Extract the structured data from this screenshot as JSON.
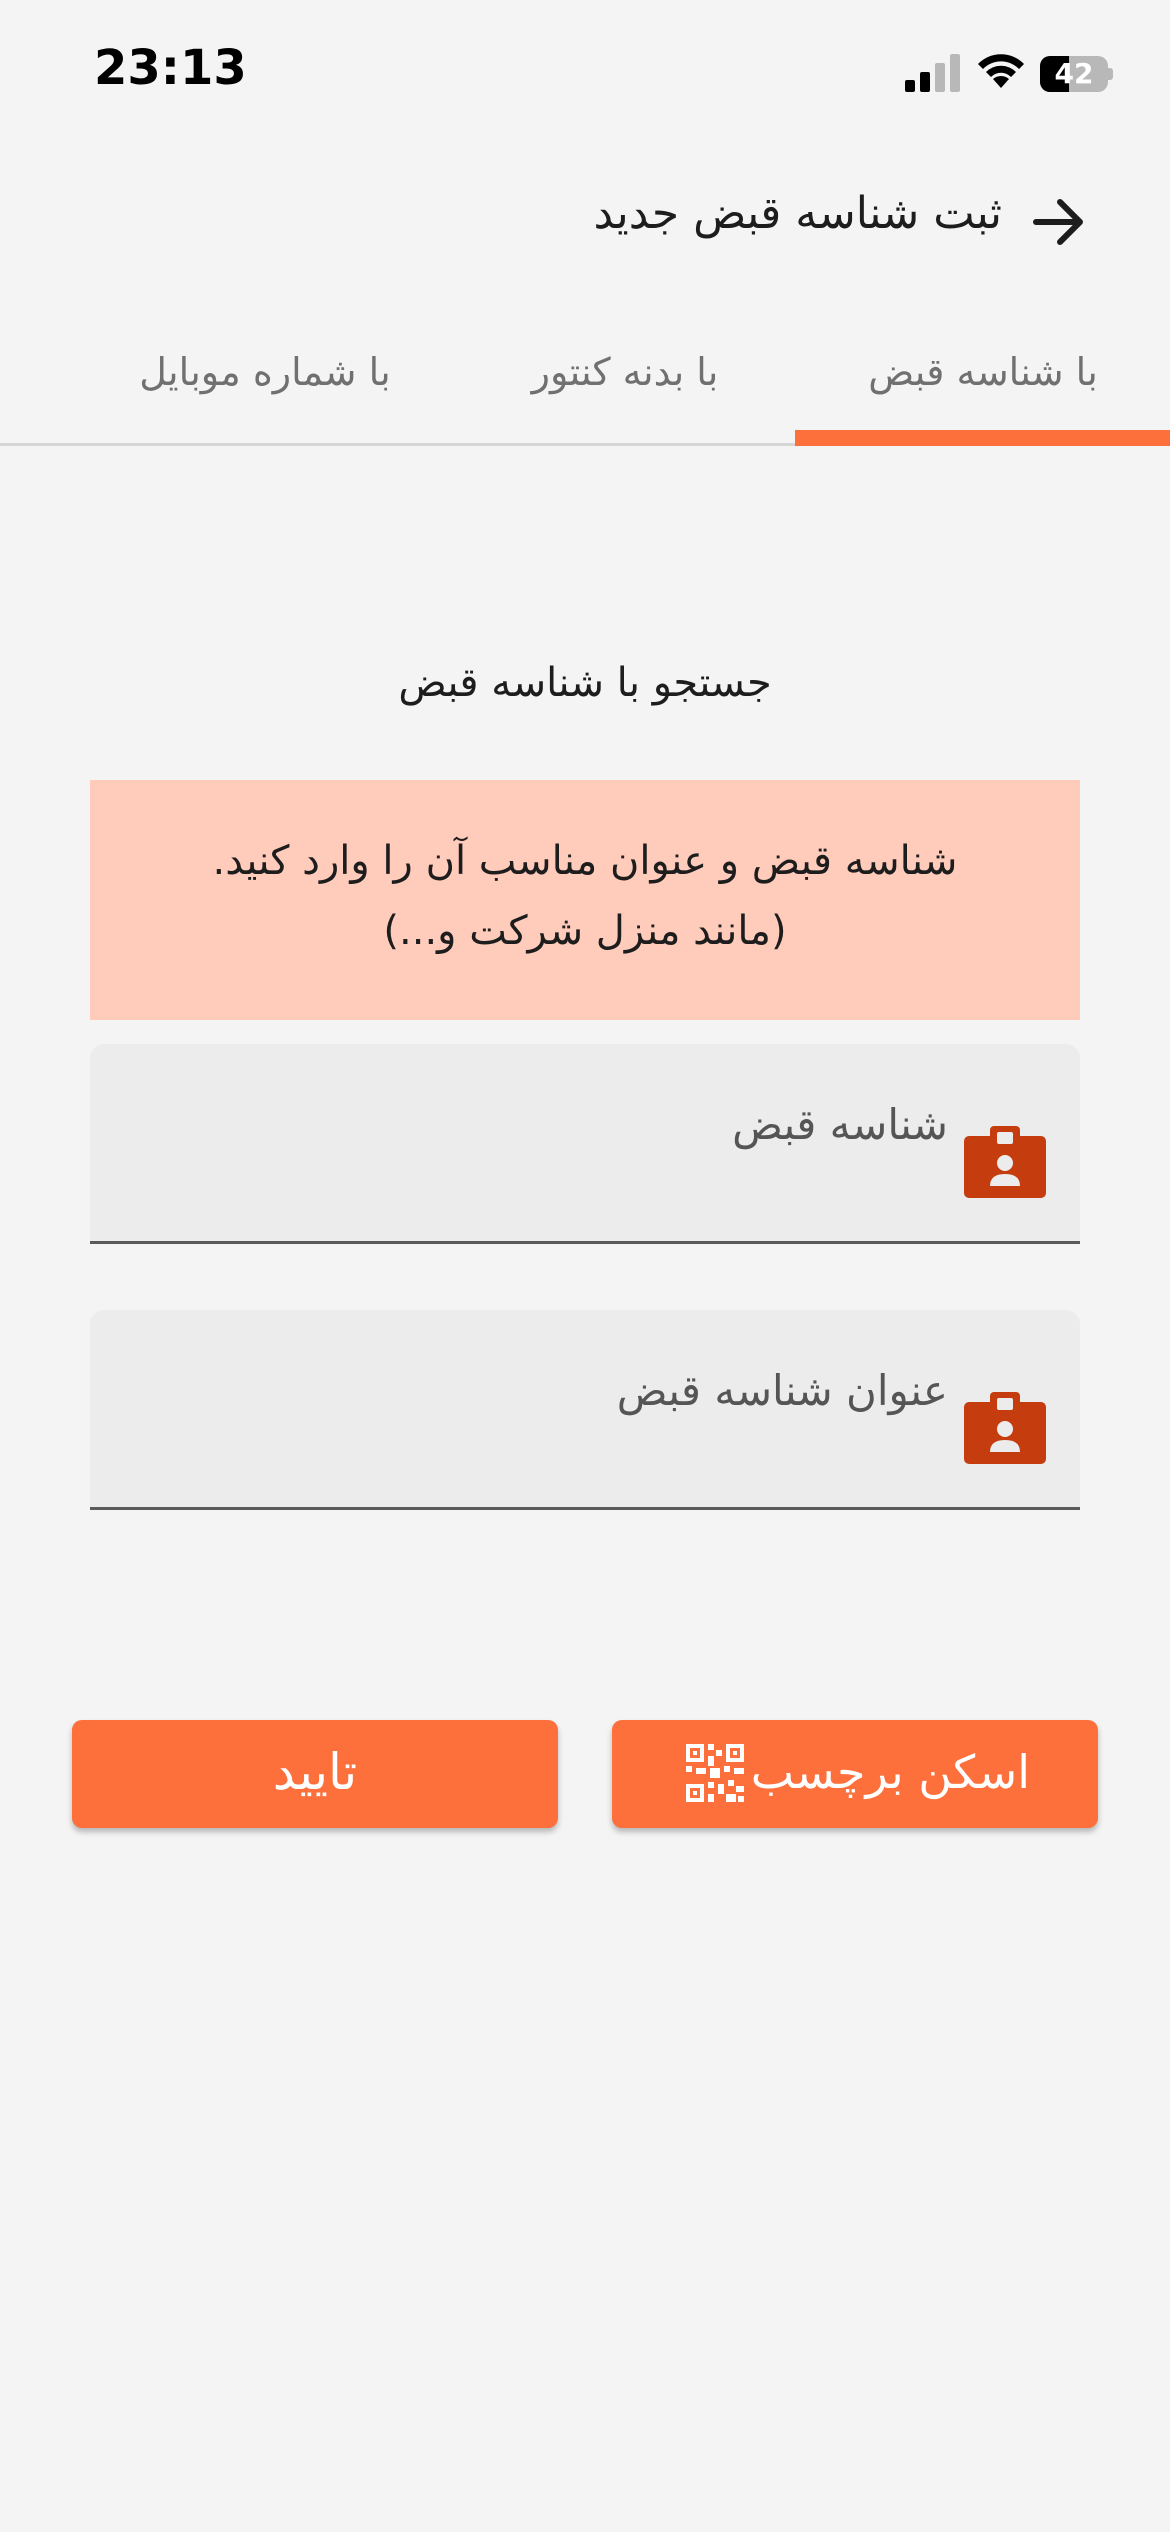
{
  "status_bar": {
    "time": "23:13",
    "battery_level": 42,
    "battery_text": "42",
    "signal_icon": "cellular-signal-icon",
    "wifi_icon": "wifi-icon"
  },
  "header": {
    "title": "ثبت شناسه قبض جدید",
    "back_icon": "arrow-right-icon"
  },
  "tabs": [
    {
      "label": "با شناسه قبض",
      "active": true
    },
    {
      "label": "با بدنه کنتور",
      "active": false
    },
    {
      "label": "با شماره موبایل",
      "active": false
    }
  ],
  "main": {
    "section_title": "جستجو با شناسه قبض",
    "notice": {
      "line1": "شناسه قبض و عنوان مناسب آن را وارد کنید.",
      "line2": "(مانند منزل شرکت و...)"
    },
    "fields": [
      {
        "label": "شناسه قبض",
        "value": "",
        "icon": "id-badge-icon"
      },
      {
        "label": "عنوان شناسه قبض",
        "value": "",
        "icon": "id-badge-icon"
      }
    ],
    "buttons": {
      "scan_label": "اسکن برچسب",
      "scan_icon": "qr-code-icon",
      "confirm_label": "تایید"
    }
  },
  "colors": {
    "accent": "#fd6f3b",
    "notice_bg": "#ffcbbb",
    "icon": "#c53d0e",
    "background": "#f4f4f4"
  }
}
